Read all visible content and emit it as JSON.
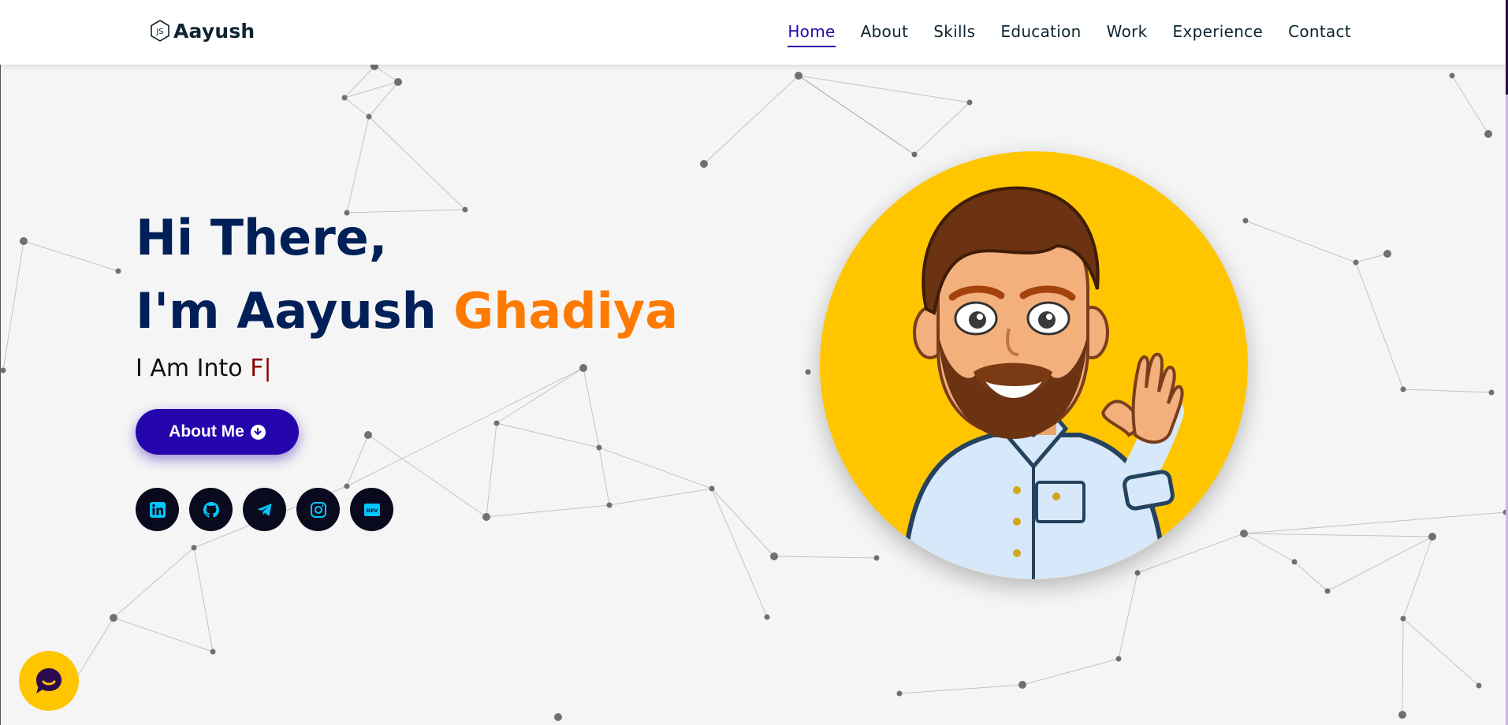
{
  "brand": {
    "name": "Aayush",
    "logo_icon": "nodejs-hexagon-icon"
  },
  "nav": {
    "items": [
      {
        "label": "Home",
        "active": true
      },
      {
        "label": "About",
        "active": false
      },
      {
        "label": "Skills",
        "active": false
      },
      {
        "label": "Education",
        "active": false
      },
      {
        "label": "Work",
        "active": false
      },
      {
        "label": "Experience",
        "active": false
      },
      {
        "label": "Contact",
        "active": false
      }
    ]
  },
  "hero": {
    "greeting_line1": "Hi There,",
    "greeting_line2_prefix": "I'm Aayush",
    "greeting_line2_highlight": "Ghadiya",
    "typed_prefix": "I Am Into",
    "typed_text": "F",
    "typed_cursor": "|",
    "about_button_label": "About Me",
    "about_button_icon": "arrow-circle-down-icon"
  },
  "socials": [
    {
      "name": "linkedin-icon"
    },
    {
      "name": "github-icon"
    },
    {
      "name": "telegram-icon"
    },
    {
      "name": "instagram-icon"
    },
    {
      "name": "dev-icon",
      "text": "DEV"
    }
  ],
  "colors": {
    "heading": "#002057",
    "highlight": "#ff7a00",
    "accent": "#2506ad",
    "typed": "#8b0000",
    "avatar_bg": "#ffc600",
    "social_bg": "#0a0a1e",
    "social_icon": "#00c8ff",
    "chat_bg": "#ffc600",
    "chat_icon": "#2c0a4e"
  },
  "chat": {
    "icon": "chat-bubble-icon"
  }
}
